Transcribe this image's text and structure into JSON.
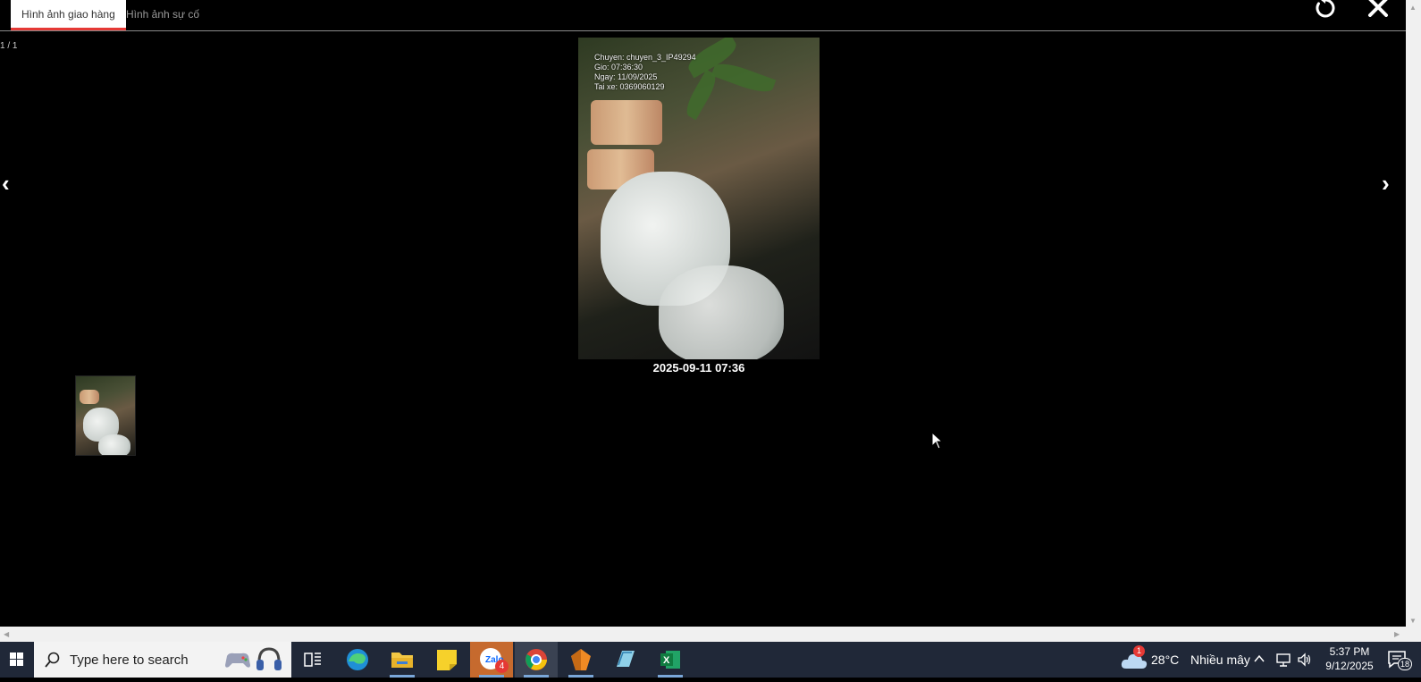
{
  "tabs": [
    {
      "label": "Hình ảnh giao hàng",
      "active": true
    },
    {
      "label": "Hình ảnh sự cố",
      "active": false
    }
  ],
  "toolbar": {
    "rotate_icon": "rotate-icon",
    "close_icon": "close-icon"
  },
  "viewer": {
    "counter": "1 / 1",
    "prev_label": "‹",
    "next_label": "›",
    "overlay": {
      "line1": "Chuyen: chuyen_3_IP49294",
      "line2": "Gio: 07:36:30",
      "line3": "Ngay: 11/09/2025",
      "line4": "Tai xe: 0369060129"
    },
    "caption": "2025-09-11 07:36"
  },
  "taskbar": {
    "search_placeholder": "Type here to search",
    "apps": [
      "task-view-icon",
      "edge-icon",
      "file-explorer-icon",
      "sticky-notes-icon",
      "zalo-icon",
      "chrome-icon",
      "app-orange-icon",
      "app-blue-icon",
      "excel-icon"
    ],
    "zalo_badge": "4",
    "weather": {
      "badge": "1",
      "temp": "28°C",
      "desc": "Nhiều mây"
    },
    "clock": {
      "time": "5:37 PM",
      "date": "9/12/2025"
    },
    "notif_count": "18"
  },
  "colors": {
    "accent_tab": "#e53935",
    "taskbar_bg": "#202838"
  }
}
